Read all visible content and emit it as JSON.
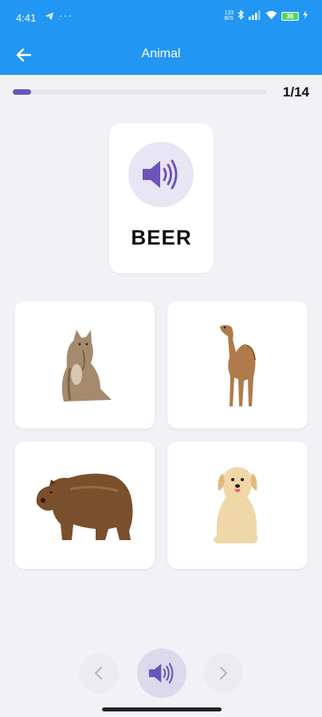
{
  "status_bar": {
    "time": "4:41",
    "net_speed_top": "133",
    "net_speed_bottom": "B/S",
    "battery_level": "36",
    "icons": [
      "telegram-icon",
      "more-dots-icon",
      "bluetooth-icon",
      "signal-icon",
      "wifi-icon",
      "battery-icon",
      "charging-icon"
    ]
  },
  "app_bar": {
    "title": "Animal",
    "back_icon": "arrow-left-icon"
  },
  "progress": {
    "current": 1,
    "total": 14,
    "label": "1/14",
    "color": "#6b55b9"
  },
  "question": {
    "word": "BEER",
    "speaker_icon": "speaker-icon"
  },
  "options": [
    {
      "animal": "cat"
    },
    {
      "animal": "camel"
    },
    {
      "animal": "bear"
    },
    {
      "animal": "dog"
    }
  ],
  "controls": {
    "prev_icon": "chevron-left-icon",
    "play_icon": "speaker-icon",
    "next_icon": "chevron-right-icon"
  },
  "colors": {
    "header": "#2196f3",
    "accent": "#6b55b9",
    "background": "#f1f1f6"
  }
}
